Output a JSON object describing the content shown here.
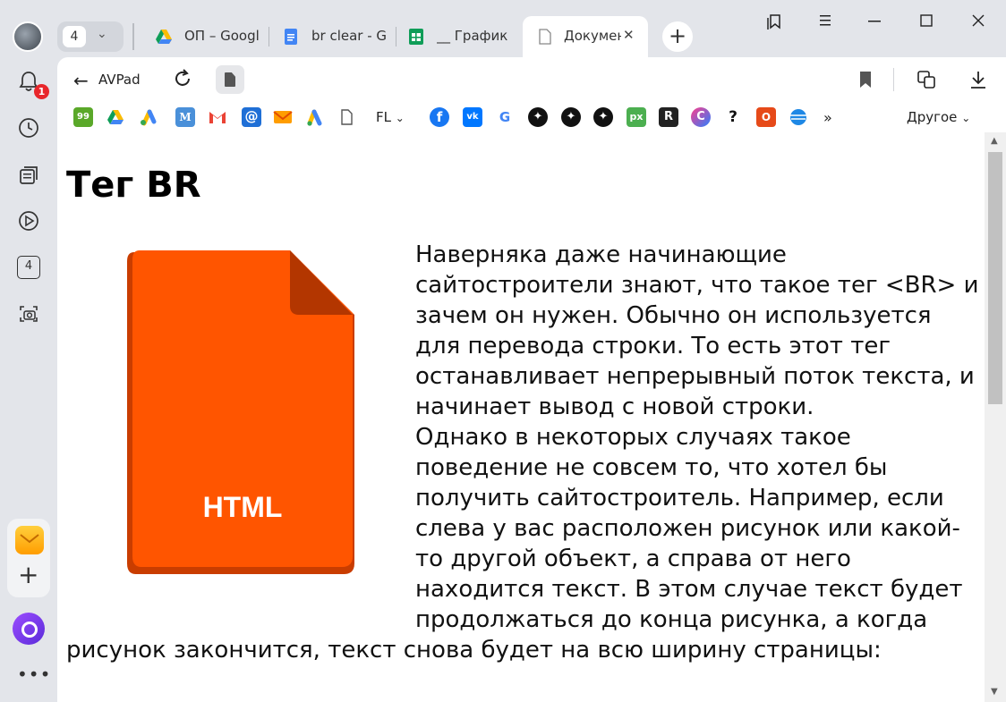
{
  "tabs": {
    "group_count": "4",
    "items": [
      {
        "title": "ОП – Google",
        "icon": "google-drive-icon"
      },
      {
        "title": "br clear - Google",
        "icon": "google-docs-icon"
      },
      {
        "title": "__ График р",
        "icon": "google-sheets-icon"
      },
      {
        "title": "Документ",
        "icon": "document-icon",
        "active": true
      }
    ]
  },
  "sidebar": {
    "notification_badge": "1",
    "tab_count": "4"
  },
  "toolbar": {
    "site_name": "AVPad"
  },
  "bookmarks": {
    "fl_label": "FL",
    "other_label": "Другое"
  },
  "page": {
    "title": "Тег BR",
    "image_label": "HTML",
    "paragraph1": "Наверняка даже начинающие сайтостроители знают, что такое тег <BR> и зачем он нужен. Обычно он используется для перевода строки. То есть этот тег останавливает непрерывный поток текста, и начинает вывод с новой строки.",
    "paragraph2": "Однако в некоторых случаях такое поведение не совсем то, что хотел бы получить сайтостроитель. Например, если слева у вас расположен рисунок или какой-то другой объект, а справа от него находится текст. В этом случае текст будет продолжаться до конца рисунка, а когда рисунок закончится, текст снова будет на всю ширину страницы:"
  },
  "colors": {
    "html_icon": "#ff5500",
    "html_icon_dark": "#c93d00"
  }
}
